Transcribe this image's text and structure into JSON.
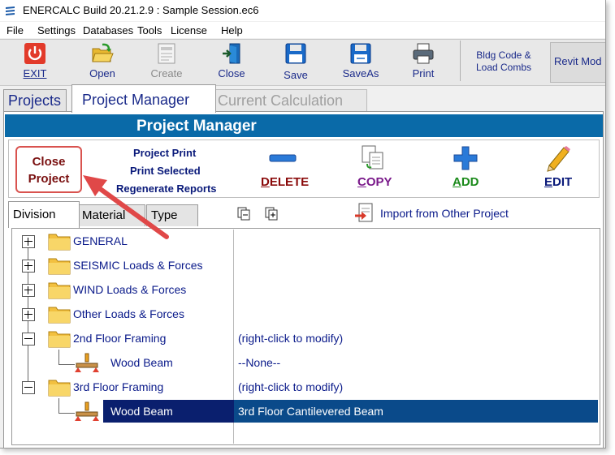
{
  "window": {
    "title": "ENERCALC Build 20.21.2.9 :  Sample Session.ec6"
  },
  "menu": [
    "File",
    "Settings",
    "Databases",
    "Tools",
    "License",
    "Help"
  ],
  "toolbar": {
    "exit": "EXIT",
    "open": "Open",
    "create": "Create",
    "close": "Close",
    "save": "Save",
    "saveas": "SaveAs",
    "print": "Print",
    "bldg_code_line1": "Bldg Code &",
    "bldg_code_line2": "Load Combs",
    "revit": "Revit Mod"
  },
  "main_tabs": {
    "projects": "Projects",
    "project_manager": "Project Manager",
    "current_calculation": "Current Calculation"
  },
  "header": {
    "title": "Project Manager"
  },
  "commands": {
    "close_line1": "Close",
    "close_line2": "Project",
    "project_print": "Project Print",
    "print_selected": "Print Selected",
    "regenerate_reports": "Regenerate Reports",
    "delete_first": "D",
    "delete_rest": "ELETE",
    "copy_first": "C",
    "copy_rest": "OPY",
    "add_first": "A",
    "add_rest": "DD",
    "edit_first": "E",
    "edit_rest": "DIT"
  },
  "sub_tabs": {
    "division": "Division",
    "material": "Material",
    "type": "Type"
  },
  "import": {
    "label": "Import from Other Project"
  },
  "tree": {
    "general": "GENERAL",
    "seismic": "SEISMIC Loads & Forces",
    "wind": "WIND Loads & Forces",
    "other": "Other Loads & Forces",
    "floor2": "2nd Floor Framing",
    "floor2_note": "(right-click to modify)",
    "floor2_beam": "Wood Beam",
    "floor2_beam_note": "--None--",
    "floor3": "3rd Floor Framing",
    "floor3_note": "(right-click to modify)",
    "floor3_beam": "Wood Beam",
    "floor3_beam_note": "3rd Floor Cantilevered Beam"
  },
  "colors": {
    "header_blue": "#0a6aa8",
    "selection": "#0a1f6e",
    "annotation_red": "#e04848",
    "delete_red": "#8a0a0a",
    "copy_purple": "#7a1a8a",
    "add_green": "#1a8a1a",
    "edit_blue": "#0a1a7a"
  },
  "icons": {
    "exit": "power-icon",
    "open": "open-folder-icon",
    "create": "new-document-icon",
    "close": "door-exit-icon",
    "save": "floppy-disk-icon",
    "saveas": "floppy-disk-icon",
    "print": "printer-icon",
    "delete": "minus-icon",
    "copy": "copy-pages-icon",
    "add": "plus-icon",
    "edit": "pencil-icon",
    "beam": "beam-icon"
  }
}
